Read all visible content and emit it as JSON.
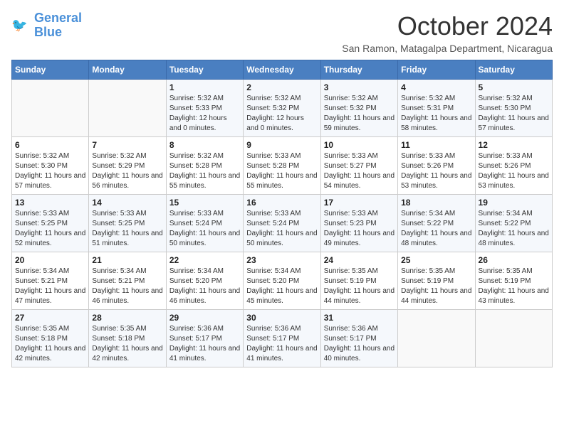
{
  "logo": {
    "line1": "General",
    "line2": "Blue"
  },
  "title": "October 2024",
  "location": "San Ramon, Matagalpa Department, Nicaragua",
  "weekdays": [
    "Sunday",
    "Monday",
    "Tuesday",
    "Wednesday",
    "Thursday",
    "Friday",
    "Saturday"
  ],
  "weeks": [
    [
      {
        "day": "",
        "sunrise": "",
        "sunset": "",
        "daylight": ""
      },
      {
        "day": "",
        "sunrise": "",
        "sunset": "",
        "daylight": ""
      },
      {
        "day": "1",
        "sunrise": "Sunrise: 5:32 AM",
        "sunset": "Sunset: 5:33 PM",
        "daylight": "Daylight: 12 hours and 0 minutes."
      },
      {
        "day": "2",
        "sunrise": "Sunrise: 5:32 AM",
        "sunset": "Sunset: 5:32 PM",
        "daylight": "Daylight: 12 hours and 0 minutes."
      },
      {
        "day": "3",
        "sunrise": "Sunrise: 5:32 AM",
        "sunset": "Sunset: 5:32 PM",
        "daylight": "Daylight: 11 hours and 59 minutes."
      },
      {
        "day": "4",
        "sunrise": "Sunrise: 5:32 AM",
        "sunset": "Sunset: 5:31 PM",
        "daylight": "Daylight: 11 hours and 58 minutes."
      },
      {
        "day": "5",
        "sunrise": "Sunrise: 5:32 AM",
        "sunset": "Sunset: 5:30 PM",
        "daylight": "Daylight: 11 hours and 57 minutes."
      }
    ],
    [
      {
        "day": "6",
        "sunrise": "Sunrise: 5:32 AM",
        "sunset": "Sunset: 5:30 PM",
        "daylight": "Daylight: 11 hours and 57 minutes."
      },
      {
        "day": "7",
        "sunrise": "Sunrise: 5:32 AM",
        "sunset": "Sunset: 5:29 PM",
        "daylight": "Daylight: 11 hours and 56 minutes."
      },
      {
        "day": "8",
        "sunrise": "Sunrise: 5:32 AM",
        "sunset": "Sunset: 5:28 PM",
        "daylight": "Daylight: 11 hours and 55 minutes."
      },
      {
        "day": "9",
        "sunrise": "Sunrise: 5:33 AM",
        "sunset": "Sunset: 5:28 PM",
        "daylight": "Daylight: 11 hours and 55 minutes."
      },
      {
        "day": "10",
        "sunrise": "Sunrise: 5:33 AM",
        "sunset": "Sunset: 5:27 PM",
        "daylight": "Daylight: 11 hours and 54 minutes."
      },
      {
        "day": "11",
        "sunrise": "Sunrise: 5:33 AM",
        "sunset": "Sunset: 5:26 PM",
        "daylight": "Daylight: 11 hours and 53 minutes."
      },
      {
        "day": "12",
        "sunrise": "Sunrise: 5:33 AM",
        "sunset": "Sunset: 5:26 PM",
        "daylight": "Daylight: 11 hours and 53 minutes."
      }
    ],
    [
      {
        "day": "13",
        "sunrise": "Sunrise: 5:33 AM",
        "sunset": "Sunset: 5:25 PM",
        "daylight": "Daylight: 11 hours and 52 minutes."
      },
      {
        "day": "14",
        "sunrise": "Sunrise: 5:33 AM",
        "sunset": "Sunset: 5:25 PM",
        "daylight": "Daylight: 11 hours and 51 minutes."
      },
      {
        "day": "15",
        "sunrise": "Sunrise: 5:33 AM",
        "sunset": "Sunset: 5:24 PM",
        "daylight": "Daylight: 11 hours and 50 minutes."
      },
      {
        "day": "16",
        "sunrise": "Sunrise: 5:33 AM",
        "sunset": "Sunset: 5:24 PM",
        "daylight": "Daylight: 11 hours and 50 minutes."
      },
      {
        "day": "17",
        "sunrise": "Sunrise: 5:33 AM",
        "sunset": "Sunset: 5:23 PM",
        "daylight": "Daylight: 11 hours and 49 minutes."
      },
      {
        "day": "18",
        "sunrise": "Sunrise: 5:34 AM",
        "sunset": "Sunset: 5:22 PM",
        "daylight": "Daylight: 11 hours and 48 minutes."
      },
      {
        "day": "19",
        "sunrise": "Sunrise: 5:34 AM",
        "sunset": "Sunset: 5:22 PM",
        "daylight": "Daylight: 11 hours and 48 minutes."
      }
    ],
    [
      {
        "day": "20",
        "sunrise": "Sunrise: 5:34 AM",
        "sunset": "Sunset: 5:21 PM",
        "daylight": "Daylight: 11 hours and 47 minutes."
      },
      {
        "day": "21",
        "sunrise": "Sunrise: 5:34 AM",
        "sunset": "Sunset: 5:21 PM",
        "daylight": "Daylight: 11 hours and 46 minutes."
      },
      {
        "day": "22",
        "sunrise": "Sunrise: 5:34 AM",
        "sunset": "Sunset: 5:20 PM",
        "daylight": "Daylight: 11 hours and 46 minutes."
      },
      {
        "day": "23",
        "sunrise": "Sunrise: 5:34 AM",
        "sunset": "Sunset: 5:20 PM",
        "daylight": "Daylight: 11 hours and 45 minutes."
      },
      {
        "day": "24",
        "sunrise": "Sunrise: 5:35 AM",
        "sunset": "Sunset: 5:19 PM",
        "daylight": "Daylight: 11 hours and 44 minutes."
      },
      {
        "day": "25",
        "sunrise": "Sunrise: 5:35 AM",
        "sunset": "Sunset: 5:19 PM",
        "daylight": "Daylight: 11 hours and 44 minutes."
      },
      {
        "day": "26",
        "sunrise": "Sunrise: 5:35 AM",
        "sunset": "Sunset: 5:19 PM",
        "daylight": "Daylight: 11 hours and 43 minutes."
      }
    ],
    [
      {
        "day": "27",
        "sunrise": "Sunrise: 5:35 AM",
        "sunset": "Sunset: 5:18 PM",
        "daylight": "Daylight: 11 hours and 42 minutes."
      },
      {
        "day": "28",
        "sunrise": "Sunrise: 5:35 AM",
        "sunset": "Sunset: 5:18 PM",
        "daylight": "Daylight: 11 hours and 42 minutes."
      },
      {
        "day": "29",
        "sunrise": "Sunrise: 5:36 AM",
        "sunset": "Sunset: 5:17 PM",
        "daylight": "Daylight: 11 hours and 41 minutes."
      },
      {
        "day": "30",
        "sunrise": "Sunrise: 5:36 AM",
        "sunset": "Sunset: 5:17 PM",
        "daylight": "Daylight: 11 hours and 41 minutes."
      },
      {
        "day": "31",
        "sunrise": "Sunrise: 5:36 AM",
        "sunset": "Sunset: 5:17 PM",
        "daylight": "Daylight: 11 hours and 40 minutes."
      },
      {
        "day": "",
        "sunrise": "",
        "sunset": "",
        "daylight": ""
      },
      {
        "day": "",
        "sunrise": "",
        "sunset": "",
        "daylight": ""
      }
    ]
  ]
}
